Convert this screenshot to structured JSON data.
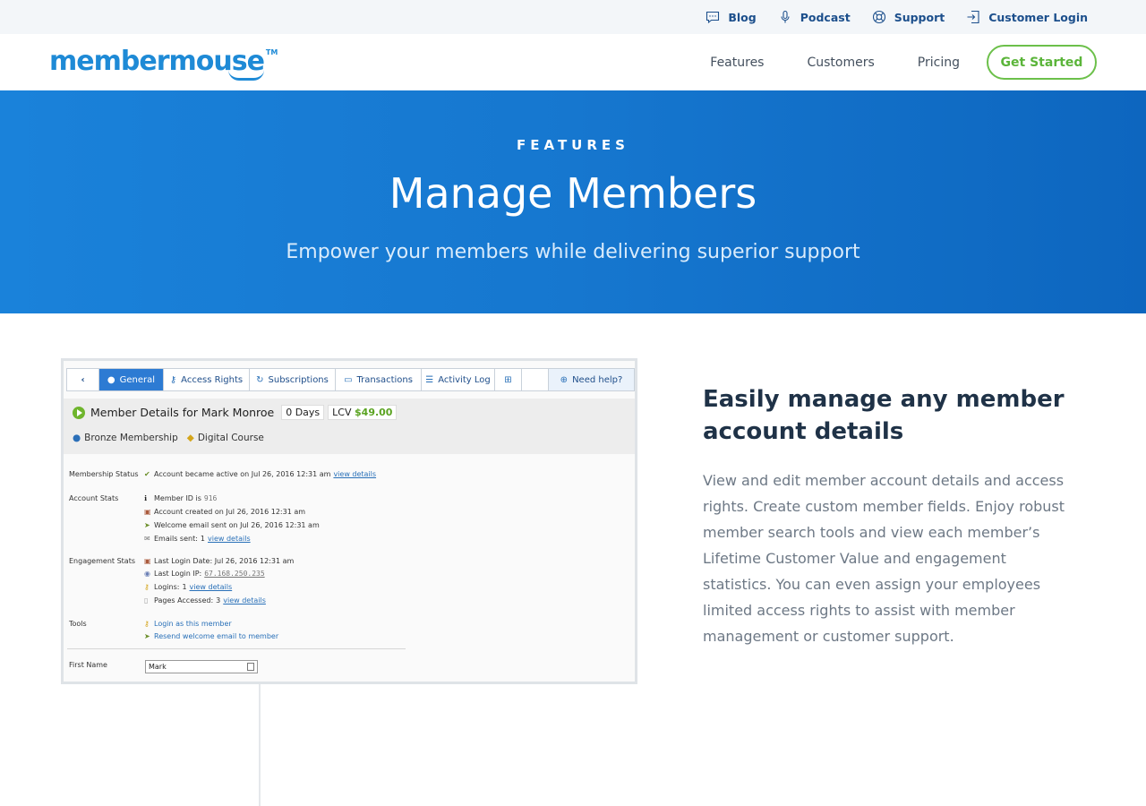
{
  "topbar": {
    "links": [
      {
        "label": "Blog",
        "icon": "chat-icon"
      },
      {
        "label": "Podcast",
        "icon": "microphone-icon"
      },
      {
        "label": "Support",
        "icon": "lifebuoy-icon"
      },
      {
        "label": "Customer Login",
        "icon": "login-icon"
      }
    ]
  },
  "nav": {
    "logo": "membermouse",
    "logo_tm": "TM",
    "items": [
      "Features",
      "Customers",
      "Pricing"
    ],
    "cta": "Get Started"
  },
  "hero": {
    "eyebrow": "FEATURES",
    "title": "Manage Members",
    "subtitle": "Empower your members while delivering superior support"
  },
  "screenshot": {
    "tabs": [
      {
        "label": "",
        "icon": "chevron-left-icon"
      },
      {
        "label": "General",
        "icon": "user-icon"
      },
      {
        "label": "Access Rights",
        "icon": "key-icon"
      },
      {
        "label": "Subscriptions",
        "icon": "refresh-icon"
      },
      {
        "label": "Transactions",
        "icon": "credit-card-icon"
      },
      {
        "label": "Activity Log",
        "icon": "list-icon"
      },
      {
        "label": "",
        "icon": "plus-icon"
      },
      {
        "label": "",
        "icon": ""
      },
      {
        "label": "Need help?",
        "icon": "lifebuoy-icon"
      }
    ],
    "header_title": "Member Details for Mark Monroe",
    "days": "0 Days",
    "lcv_label": "LCV",
    "lcv_value": "$49.00",
    "membership": "Bronze Membership",
    "bundle": "Digital Course",
    "membership_status_label": "Membership Status",
    "membership_status_value": "Account became active on Jul 26, 2016 12:31 am",
    "view_details": "view details",
    "account_stats_label": "Account Stats",
    "member_id_label": "Member ID is",
    "member_id": "916",
    "account_created": "Account created on Jul 26, 2016 12:31 am",
    "welcome_email": "Welcome email sent on Jul 26, 2016 12:31 am",
    "emails_sent_label": "Emails sent:",
    "emails_sent": "1",
    "engagement_label": "Engagement Stats",
    "last_login_date": "Last Login Date: Jul 26, 2016 12:31 am",
    "last_login_ip_label": "Last Login IP:",
    "last_login_ip": "67.168.250.235",
    "logins_label": "Logins:",
    "logins": "1",
    "pages_label": "Pages Accessed:",
    "pages": "3",
    "tools_label": "Tools",
    "login_as": "Login as this member",
    "resend_welcome": "Resend welcome email to member",
    "first_name_label": "First Name",
    "first_name_value": "Mark"
  },
  "feature": {
    "title": "Easily manage any member account details",
    "text": "View and edit member account details and access rights. Create custom member fields. Enjoy robust member search tools and view each member’s Lifetime Customer Value and engagement statistics. You can even assign your employees limited access rights to assist with member management or customer support."
  },
  "colors": {
    "brand_blue": "#1e8ad6",
    "hero_gradient_start": "#1a82da",
    "hero_gradient_end": "#0d66bf",
    "cta_green": "#6cc04a",
    "link_navy": "#1c4f8c"
  }
}
